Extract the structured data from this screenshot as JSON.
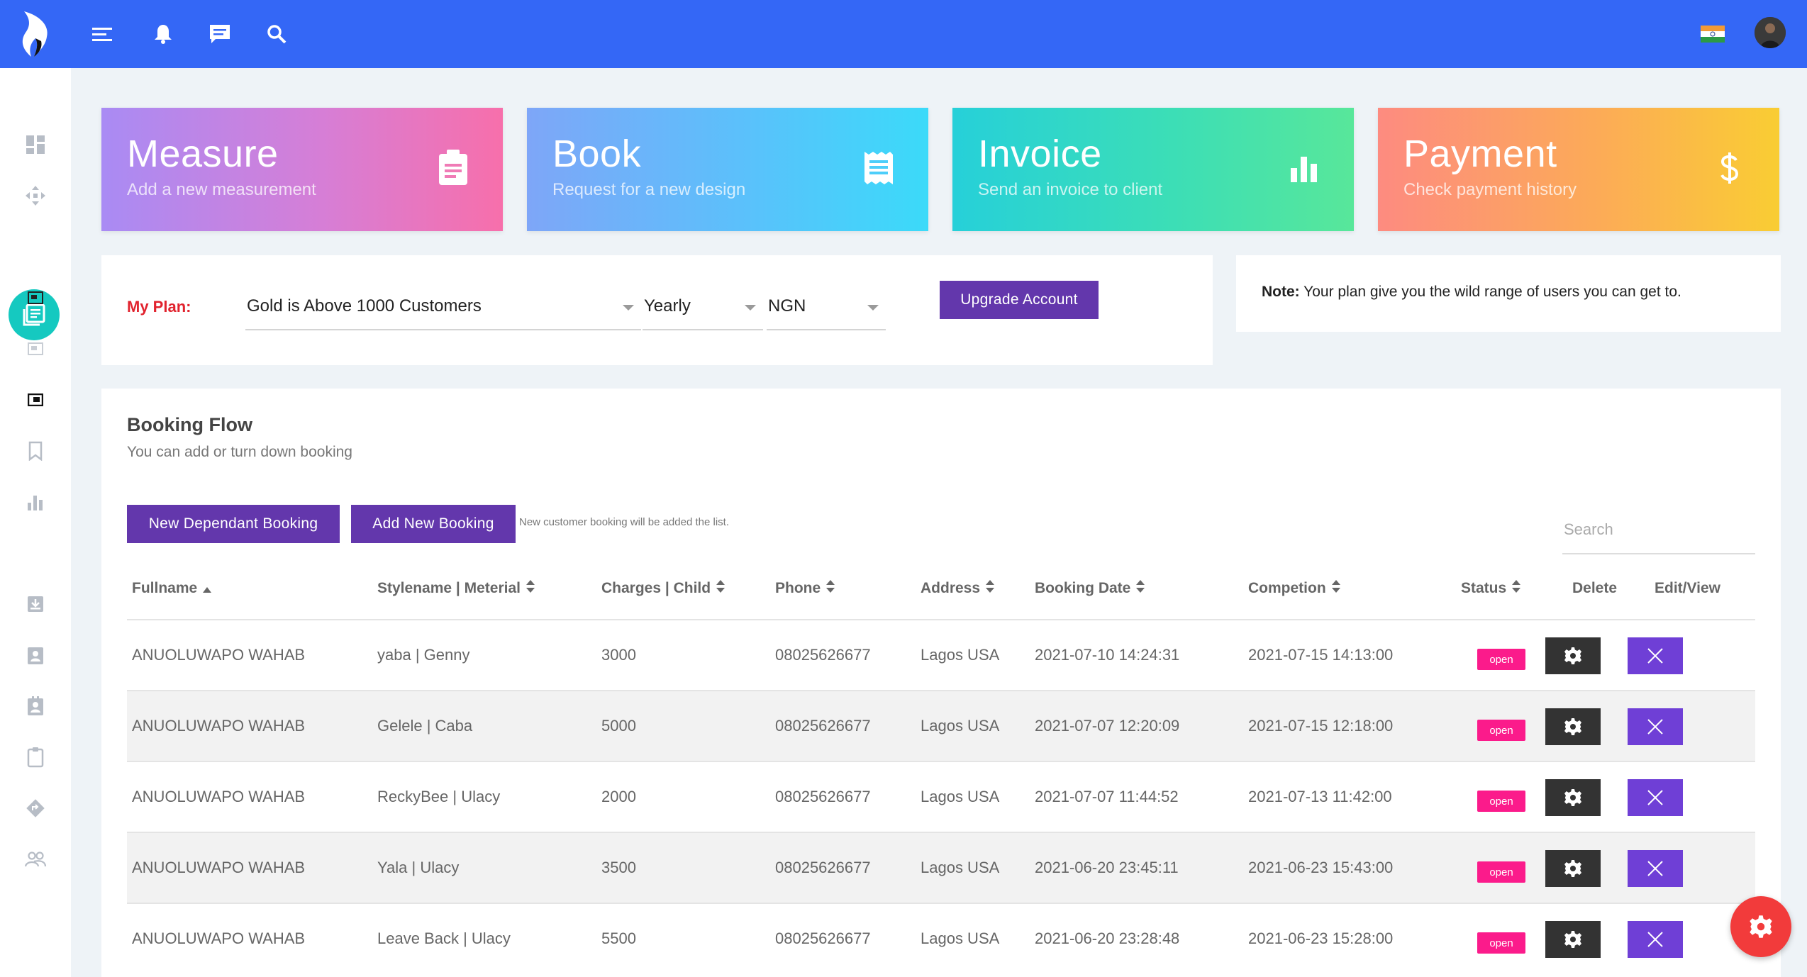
{
  "topbar": {
    "icons": [
      "menu-icon",
      "bell-icon",
      "chat-icon",
      "search-icon"
    ],
    "brand_color": "#3467f6"
  },
  "sidebar": {
    "items": [
      "dashboard-icon",
      "move-icon",
      "book-icon",
      "screen-icon",
      "screen-outline-icon",
      "window-icon",
      "bookmark-icon",
      "chart-icon",
      "download-icon",
      "contact-icon",
      "contact-alt-icon",
      "clipboard-icon",
      "directions-icon",
      "people-icon"
    ],
    "active": "book-icon",
    "active_color": "#15c9c0"
  },
  "cards": [
    {
      "title": "Measure",
      "subtitle": "Add a new measurement",
      "icon": "clipboard-icon"
    },
    {
      "title": "Book",
      "subtitle": "Request for a new design",
      "icon": "receipt-icon"
    },
    {
      "title": "Invoice",
      "subtitle": "Send an invoice to client",
      "icon": "bar-chart-icon"
    },
    {
      "title": "Payment",
      "subtitle": "Check payment history",
      "icon": "dollar-icon"
    }
  ],
  "plan": {
    "label": "My Plan:",
    "plan_value": "Gold is Above 1000 Customers",
    "cycle_value": "Yearly",
    "currency_value": "NGN",
    "upgrade_label": "Upgrade Account"
  },
  "note": {
    "bold": "Note:",
    "text": " Your plan give you the wild range of users you can get to."
  },
  "booking": {
    "title": "Booking Flow",
    "subtitle": "You can add or turn down booking",
    "new_dependant_label": "New Dependant Booking",
    "add_new_label": "Add New Booking",
    "hint": "New customer booking will be added the list.",
    "search_placeholder": "Search",
    "columns": [
      "Fullname",
      "Stylename | Meterial",
      "Charges | Child",
      "Phone",
      "Address",
      "Booking Date",
      "Competion",
      "Status",
      "Delete",
      "Edit/View"
    ],
    "rows": [
      {
        "fullname": "ANUOLUWAPO WAHAB",
        "style": "yaba | Genny",
        "charges": "3000",
        "phone": "08025626677",
        "address": "Lagos USA",
        "booking_date": "2021-07-10 14:24:31",
        "completion": "2021-07-15 14:13:00",
        "status": "open"
      },
      {
        "fullname": "ANUOLUWAPO WAHAB",
        "style": "Gelele | Caba",
        "charges": "5000",
        "phone": "08025626677",
        "address": "Lagos USA",
        "booking_date": "2021-07-07 12:20:09",
        "completion": "2021-07-15 12:18:00",
        "status": "open"
      },
      {
        "fullname": "ANUOLUWAPO WAHAB",
        "style": "ReckyBee | Ulacy",
        "charges": "2000",
        "phone": "08025626677",
        "address": "Lagos USA",
        "booking_date": "2021-07-07 11:44:52",
        "completion": "2021-07-13 11:42:00",
        "status": "open"
      },
      {
        "fullname": "ANUOLUWAPO WAHAB",
        "style": "Yala | Ulacy",
        "charges": "3500",
        "phone": "08025626677",
        "address": "Lagos USA",
        "booking_date": "2021-06-20 23:45:11",
        "completion": "2021-06-23 15:43:00",
        "status": "open"
      },
      {
        "fullname": "ANUOLUWAPO WAHAB",
        "style": "Leave Back | Ulacy",
        "charges": "5500",
        "phone": "08025626677",
        "address": "Lagos USA",
        "booking_date": "2021-06-20 23:28:48",
        "completion": "2021-06-23 15:28:00",
        "status": "open"
      }
    ]
  },
  "colors": {
    "accent_purple": "#6337ac",
    "status_open": "#fb1b8b",
    "fab": "#f23b3b"
  }
}
